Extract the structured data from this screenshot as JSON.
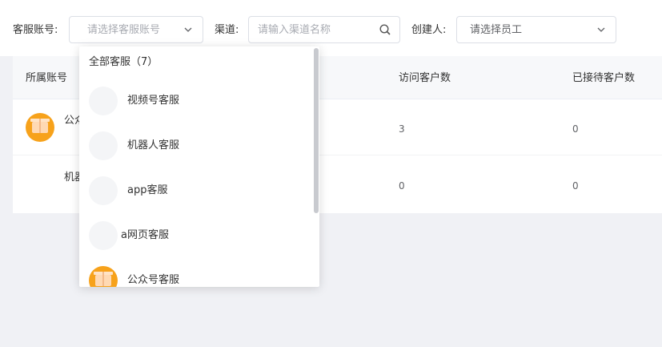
{
  "filters": {
    "account_label": "客服账号:",
    "account_placeholder": "请选择客服账号",
    "channel_label": "渠道:",
    "channel_placeholder": "请输入渠道名称",
    "creator_label": "创建人:",
    "creator_placeholder": "请选择员工"
  },
  "table": {
    "columns": [
      "所属账号",
      "访问客户数",
      "已接待客户数"
    ],
    "rows": [
      {
        "account": "公众号客服",
        "account_visible": "公众",
        "visitors": "3",
        "served": "0"
      },
      {
        "account": "机器人客服",
        "account_visible": "机器",
        "visitors": "0",
        "served": "0"
      }
    ]
  },
  "dropdown": {
    "header": "全部客服（7）",
    "items": [
      {
        "label": "视频号客服",
        "avatar": "blank"
      },
      {
        "label": "机器人客服",
        "avatar": "blank"
      },
      {
        "label": "app客服",
        "avatar": "blank"
      },
      {
        "label": "a网页客服",
        "avatar": "blank"
      },
      {
        "label": "公众号客服",
        "avatar": "orange"
      }
    ]
  },
  "colors": {
    "accent_avatar": "#f7a21b",
    "background": "#f0f1f5",
    "header_bg": "#f7f8fa"
  },
  "icons": {
    "select_arrow": "chevron-down-icon",
    "search": "search-icon"
  }
}
